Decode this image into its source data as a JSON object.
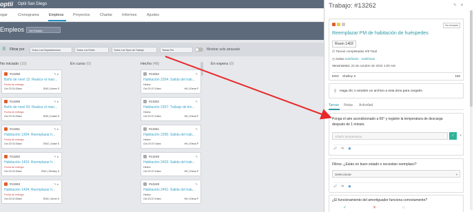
{
  "topbar": {
    "logo": "optii",
    "site": "Optii San Diego"
  },
  "nav": [
    "ogar",
    "Cronograma",
    "Empleos",
    "Proyectos",
    "Charlar",
    "Informes",
    "Ajustes"
  ],
  "page": {
    "title": "Empleos",
    "status_badge": "Ver Estado"
  },
  "filters": {
    "label": "Filtrar por",
    "selects": [
      "Todos Los Departamentos",
      "Todos Los Roles",
      "Todos Los Tipos de Trabajo",
      "Tareas Por",
      "Todos"
    ],
    "show_label": "Mostrar solo atrasado"
  },
  "columns": [
    {
      "name": "No iniciado",
      "count": "(10)"
    },
    {
      "name": "En curso",
      "count": "(0)"
    },
    {
      "name": "Hecho",
      "count": "(48)"
    },
    {
      "name": "En espera",
      "count": "(0)"
    }
  ],
  "todo_cards": [
    {
      "id": "#13258",
      "title": "Baño de nivel 12: Realice el man...",
      "label": "Fecha de entrega:",
      "date": "Oct 23 01:00am",
      "user": "ENG | Amos S"
    },
    {
      "id": "#13259",
      "title": "Baño de nivel 50: Realice el man...",
      "label": "Fecha de entrega:",
      "date": "Oct 23 01:00am",
      "user": "ENG | Kaleb S"
    },
    {
      "id": "#13261",
      "title": "Habitación 1304: Reemplazar h...",
      "label": "Fecha de entrega:",
      "date": "Oct 23 01:00am",
      "user": "ENG | Gabe S"
    },
    {
      "id": "#13262",
      "title": "Habitación 1403: Reemplazar h...",
      "label": "Fecha de entrega:",
      "date": "Oct 23 01:00am",
      "user": "ENG | Shelley S"
    },
    {
      "id": "#13263",
      "title": "Habitación 1404: Reemplazar h...",
      "label": "Fecha de entrega:",
      "date": "Oct 23 01:00am",
      "user": "ENG | Kevin S"
    }
  ],
  "done_cards": [
    {
      "id": "#13254",
      "title": "Habitación 2304: Salida del trab...",
      "label": "Hecho:",
      "date": "Oct 23 07:19am",
      "user": "HK | Elena P"
    },
    {
      "id": "#13252",
      "title": "Habitación 2307: Trabajo de lim...",
      "label": "Hecho:",
      "date": "Oct 23 07:19am",
      "user": "HK | Elena P"
    },
    {
      "id": "#13251",
      "title": "Habitación 2305: Salida del trab...",
      "label": "Hecho:",
      "date": "Oct 23 07:19am",
      "user": "HK | Elena P"
    },
    {
      "id": "#13249",
      "title": "Habitación 2403: Salida del trab...",
      "label": "Hecho:",
      "date": "Oct 23 07:19am",
      "user": "HK | Elena P"
    },
    {
      "id": "#13248",
      "title": "Habitación 2401: Salida del trab...",
      "label": "Hecho:",
      "date": "Oct 23 07:19am",
      "user": "HK | Elena P"
    }
  ],
  "panel": {
    "title": "Trabajo: #13262",
    "status": "No iniciado",
    "job_title": "Reemplazar PM de habitación de huéspedes",
    "room": "Room 1403",
    "tasks_done": "Tareas completadas",
    "tasks_count": "0/9 Total",
    "active_label": "Activo",
    "active_value": "indefinido · indefinido",
    "due_label": "Vencimiento:",
    "due_value": "23 de octubre de 2024 1:00 AM",
    "dept": "ENG",
    "assignee": "Shelley S",
    "duration": "180",
    "upload_text": "Haga clic o arrastre un archivo a esta área para cargarlo",
    "tabs": [
      "Tareas",
      "Notas",
      "Actividad"
    ],
    "task1_question": "Ponga el aire acondicionado a 65° y registre la temperatura de descarga después de 1 minuto.",
    "task1_placeholder": "Añadir temperatura",
    "task2_question": "Filtros: ¿Están en buen estado o necesitan reemplazo?",
    "task2_select": "Seleccionar",
    "task3_question": "¿El funcionamiento del amortiguador funciona correctamente?"
  },
  "colors": {
    "accent": "#2e9aa6",
    "due": "#cc4444",
    "link": "#3aa2c8",
    "arrow": "#e8282a"
  }
}
